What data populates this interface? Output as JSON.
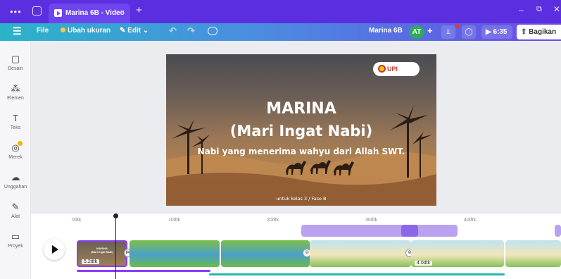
{
  "titlebar": {
    "tab_title": "Marina 6B - Video",
    "close_symbol": "×",
    "new_tab_symbol": "+",
    "dots": "•••",
    "min_symbol": "–",
    "max_symbol": "⧉",
    "close_window_symbol": "✕"
  },
  "toolbar": {
    "menu_symbol": "☰",
    "file_label": "File",
    "resize_label": "Ubah ukuran",
    "edit_label": "Edit",
    "undo_symbol": "↶",
    "redo_symbol": "↷",
    "doc_title": "Marina 6B",
    "avatar_initials": "AT",
    "add_symbol": "+",
    "chart_symbol": "⫫",
    "comment_symbol": "◯",
    "play_time": "6:35",
    "share_label": "Bagikan"
  },
  "sidebar": {
    "items": [
      {
        "label": "Desain",
        "icon": "▢"
      },
      {
        "label": "Elemen",
        "icon": "⁂"
      },
      {
        "label": "Teks",
        "icon": "T"
      },
      {
        "label": "Merek",
        "icon": "◎"
      },
      {
        "label": "Unggahan",
        "icon": "☁"
      },
      {
        "label": "Alat",
        "icon": "✎"
      },
      {
        "label": "Proyek",
        "icon": "▭"
      }
    ]
  },
  "slide": {
    "logo_text": "UPI",
    "title": "MARINA",
    "subtitle": "(Mari Ingat Nabi)",
    "tagline": "Nabi yang menerima wahyu dari Allah SWT.",
    "footer": "untuk kelas 3 / Fase B"
  },
  "timeline": {
    "ticks": [
      "0dtk",
      "10dtk",
      "20dtk",
      "30dtk",
      "40dtk"
    ],
    "first_clip_duration": "5.2dtk",
    "first_clip_title": "MARINA",
    "first_clip_subtitle": "(Mari Ingat Nabi)",
    "other_clip_duration": "4.0dtk"
  }
}
